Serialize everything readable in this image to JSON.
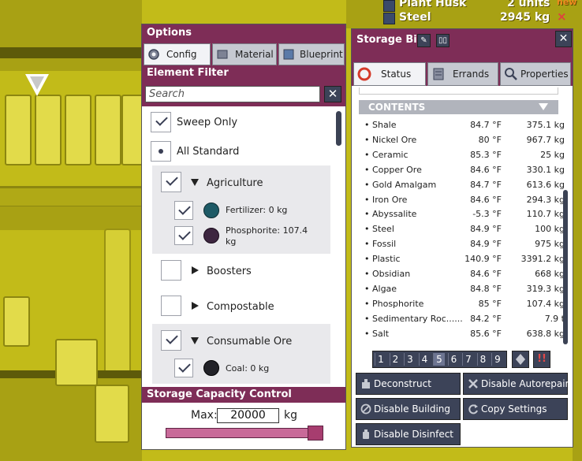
{
  "top_resources": [
    {
      "name": "Plant Husk",
      "amount": "2 units",
      "flag": "new"
    },
    {
      "name": "Steel",
      "amount": "2945 kg",
      "flag": "×"
    }
  ],
  "options": {
    "title": "Options",
    "tabs": [
      {
        "label": "Config",
        "icon": "gear-icon",
        "active": true
      },
      {
        "label": "Material",
        "icon": "material-icon",
        "active": false
      },
      {
        "label": "Blueprint",
        "icon": "blueprint-icon",
        "active": false
      }
    ],
    "element_filter": {
      "title": "Element Filter",
      "search_placeholder": "Search",
      "sweep_only": "Sweep Only",
      "all_standard": "All Standard",
      "groups": [
        {
          "label": "Agriculture",
          "checked": true,
          "expanded": true,
          "items": [
            {
              "label": "Fertilizer: 0 kg",
              "checked": true,
              "color": "#1e5a66"
            },
            {
              "label": "Phosphorite: 107.4 kg",
              "checked": true,
              "color": "#3d2640"
            }
          ]
        },
        {
          "label": "Boosters",
          "checked": false,
          "expanded": false,
          "items": []
        },
        {
          "label": "Compostable",
          "checked": false,
          "expanded": false,
          "items": []
        },
        {
          "label": "Consumable Ore",
          "checked": true,
          "expanded": true,
          "items": [
            {
              "label": "Coal: 0 kg",
              "checked": true,
              "color": "#222228"
            }
          ]
        }
      ]
    },
    "storage_capacity": {
      "title": "Storage Capacity Control",
      "max_label": "Max:",
      "max_value": "20000",
      "unit": "kg",
      "fill_fraction": 1.0
    }
  },
  "storage_bin": {
    "title": "Storage Bin",
    "tabs": [
      {
        "label": "Status",
        "icon": "status-icon",
        "active": true
      },
      {
        "label": "Errands",
        "icon": "errands-icon",
        "active": false
      },
      {
        "label": "Properties",
        "icon": "magnifier-icon",
        "active": false
      }
    ],
    "contents_header": "CONTENTS",
    "contents": [
      {
        "name": "• Shale",
        "temp": "84.7 °F",
        "mass": "375.1 kg"
      },
      {
        "name": "• Nickel Ore",
        "temp": "80 °F",
        "mass": "967.7 kg"
      },
      {
        "name": "• Ceramic",
        "temp": "85.3 °F",
        "mass": "25 kg"
      },
      {
        "name": "• Copper Ore",
        "temp": "84.6 °F",
        "mass": "330.1 kg"
      },
      {
        "name": "• Gold Amalgam",
        "temp": "84.7 °F",
        "mass": "613.6 kg"
      },
      {
        "name": "• Iron Ore",
        "temp": "84.6 °F",
        "mass": "294.3 kg"
      },
      {
        "name": "• Abyssalite",
        "temp": "-5.3 °F",
        "mass": "110.7 kg"
      },
      {
        "name": "• Steel",
        "temp": "84.9 °F",
        "mass": "100 kg"
      },
      {
        "name": "• Fossil",
        "temp": "84.9 °F",
        "mass": "975 kg"
      },
      {
        "name": "• Plastic",
        "temp": "140.9 °F",
        "mass": "3391.2 kg"
      },
      {
        "name": "• Obsidian",
        "temp": "84.6 °F",
        "mass": "668 kg"
      },
      {
        "name": "• Algae",
        "temp": "84.8 °F",
        "mass": "319.3 kg"
      },
      {
        "name": "• Phosphorite",
        "temp": "85 °F",
        "mass": "107.4 kg"
      },
      {
        "name": "• Sedimentary Roc......",
        "temp": "84.2 °F",
        "mass": "7.9 t"
      },
      {
        "name": "• Salt",
        "temp": "85.6 °F",
        "mass": "638.8 kg"
      }
    ],
    "speed_pages": [
      "1",
      "2",
      "3",
      "4",
      "5",
      "6",
      "7",
      "8",
      "9"
    ],
    "selected_page": "5",
    "alert_label": "!!",
    "actions": [
      {
        "label": "Deconstruct",
        "icon": "deconstruct-icon"
      },
      {
        "label": "Disable Autorepair",
        "icon": "repair-icon"
      },
      {
        "label": "Disable Building",
        "icon": "disable-icon"
      },
      {
        "label": "Copy Settings",
        "icon": "copy-icon"
      },
      {
        "label": "Disable Disinfect",
        "icon": "disinfect-icon"
      }
    ]
  },
  "colors": {
    "window_header": "#7e2d57",
    "button_dark": "#3c4358",
    "background": "#c2bb19"
  }
}
